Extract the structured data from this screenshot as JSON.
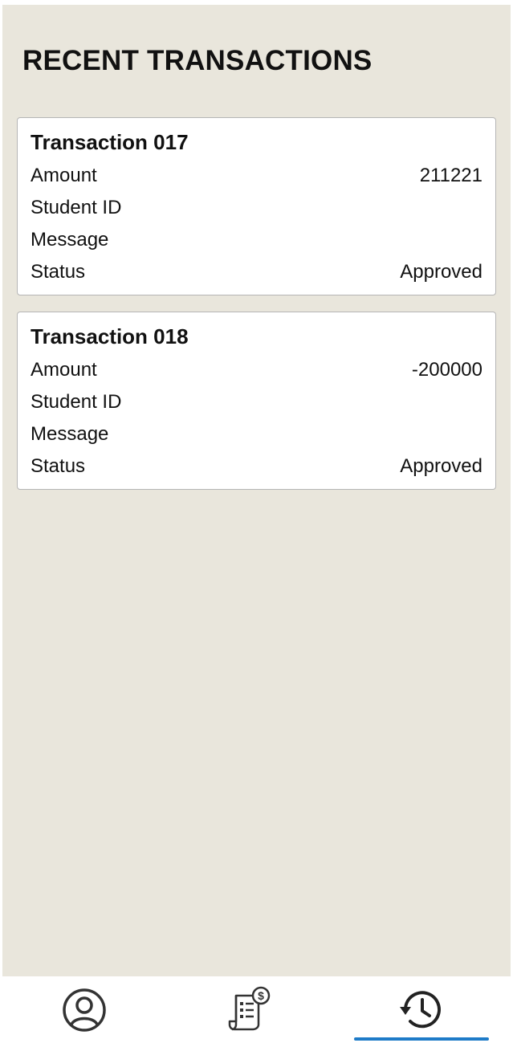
{
  "page": {
    "title": "RECENT TRANSACTIONS"
  },
  "transactions": [
    {
      "title": "Transaction 017",
      "amount_label": "Amount",
      "amount_value": "211221",
      "student_id_label": "Student ID",
      "student_id_value": "",
      "message_label": "Message",
      "message_value": "",
      "status_label": "Status",
      "status_value": "Approved"
    },
    {
      "title": "Transaction 018",
      "amount_label": "Amount",
      "amount_value": "-200000",
      "student_id_label": "Student ID",
      "student_id_value": "",
      "message_label": "Message",
      "message_value": "",
      "status_label": "Status",
      "status_value": "Approved"
    }
  ],
  "bottom_nav": {
    "items": [
      {
        "icon": "user-profile-icon",
        "active": false
      },
      {
        "icon": "bill-payment-icon",
        "active": false
      },
      {
        "icon": "history-icon",
        "active": true
      }
    ],
    "active_color": "#1e7bc8"
  },
  "colors": {
    "background": "#e9e6dc",
    "card": "#ffffff",
    "text": "#111111"
  }
}
